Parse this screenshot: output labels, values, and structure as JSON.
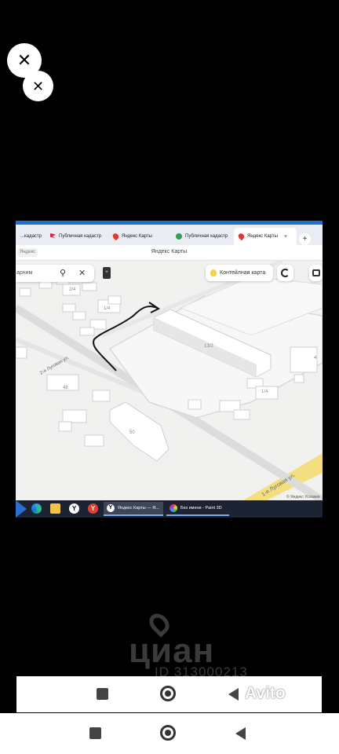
{
  "overlay": {
    "close_glyph": "✕"
  },
  "browser": {
    "tabs": [
      {
        "label": "...кадастр",
        "icon": ""
      },
      {
        "label": "Публичная кадастр",
        "icon": "flag-icon"
      },
      {
        "label": "Яндекс Карты",
        "icon": "pin-icon"
      },
      {
        "label": "Публичная кадастр",
        "icon": "check-icon"
      },
      {
        "label": "Яндекс Карты",
        "icon": "pin-icon",
        "active": true
      }
    ],
    "tab_close": "×",
    "new_tab": "+",
    "address_pill": "Яндекс",
    "page_title": "Яндекс Карты"
  },
  "map": {
    "search_text": "арним",
    "search_icon": "⚲",
    "clear_icon": "✕",
    "layers_label": "+",
    "contour_label": "Контейлная карта",
    "copyright": "© Яндекс Условия",
    "labels": {
      "b1": "2/4",
      "b2": "1/4",
      "b3": "13/2",
      "b4": "1/4",
      "b5": "50",
      "b6": "48",
      "b7": "4",
      "street1": "2-я Луговая ул.",
      "street2": "1-я Луговая ул."
    }
  },
  "taskbar": {
    "task1": "Яндекс Карты — Я...",
    "task2": "Без имени - Paint 3D",
    "yandex_letter": "Y"
  },
  "watermark": {
    "brand": "циан",
    "id": "ID 313000213",
    "avito": "Avito"
  },
  "colors": {
    "tab_accent": "#1f6fd1",
    "taskbar": "#1c2433",
    "road": "#f3df80"
  }
}
